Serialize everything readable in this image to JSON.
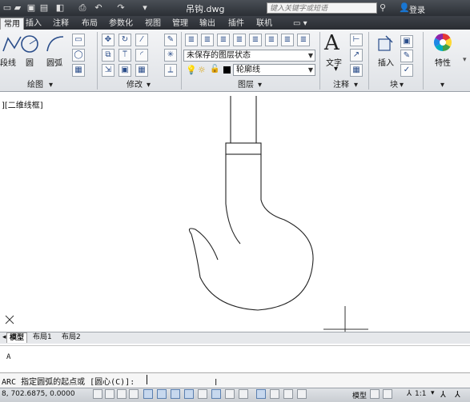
{
  "window": {
    "document_title": "吊钩.dwg",
    "search_placeholder": "键入关键字或短语",
    "login_label": "登录"
  },
  "ribbon_tabs": [
    "常用",
    "插入",
    "注释",
    "布局",
    "参数化",
    "视图",
    "管理",
    "输出",
    "插件",
    "联机"
  ],
  "active_tab": "常用",
  "panels": {
    "draw": {
      "title": "绘图",
      "polyline_label": "段线",
      "circle_label": "圆",
      "arc_label": "圆弧"
    },
    "modify": {
      "title": "修改"
    },
    "layers": {
      "title": "图层",
      "layer_state": "未保存的图层状态",
      "current_layer": "轮廓线"
    },
    "annotation": {
      "title": "注释",
      "text_label": "文字"
    },
    "block": {
      "title": "块",
      "insert_label": "插入"
    },
    "properties": {
      "title": "",
      "label": "特性"
    }
  },
  "viewport": {
    "label": "][二维线框]"
  },
  "layout_tabs": [
    "模型",
    "布局1",
    "布局2"
  ],
  "active_layout": "模型",
  "command": {
    "history": "A",
    "prompt": "ARC 指定圆弧的起点或 [圆心(C)]:"
  },
  "status": {
    "coordinates": "8, 702.6875, 0.0000",
    "model_label": "模型",
    "scale_label": "1:1"
  }
}
